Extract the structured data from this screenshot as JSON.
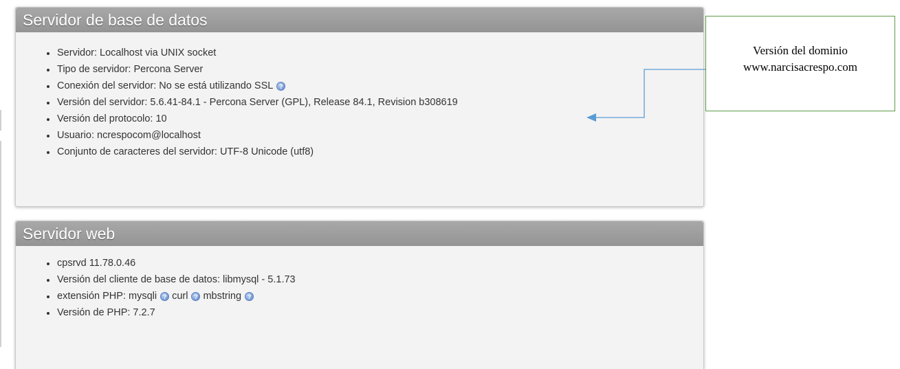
{
  "db_server": {
    "title": "Servidor de base de datos",
    "items": [
      "Servidor: Localhost via UNIX socket",
      "Tipo de servidor: Percona Server",
      "Conexión del servidor: No se está utilizando SSL",
      "Versión del servidor: 5.6.41-84.1 - Percona Server (GPL), Release 84.1, Revision b308619",
      "Versión del protocolo: 10",
      "Usuario: ncrespocom@localhost",
      "Conjunto de caracteres del servidor: UTF-8 Unicode (utf8)"
    ]
  },
  "web_server": {
    "title": "Servidor web",
    "item_1": "cpsrvd 11.78.0.46",
    "item_2": "Versión del cliente de base de datos: libmysql - 5.1.73",
    "php_extension_label": "extensión PHP:",
    "php_extensions": [
      "mysqli",
      "curl",
      "mbstring"
    ],
    "item_4": "Versión de PHP: 7.2.7"
  },
  "callout": {
    "line_1": "Versión del dominio",
    "line_2": "www.narcisacrespo.com"
  },
  "icons": {
    "documentation": "documentation-icon"
  },
  "colors": {
    "header_background": "#9e9e9e",
    "panel_background": "#f3f3f3",
    "callout_border": "#5a9b45",
    "arrow": "#5b9bd5"
  }
}
